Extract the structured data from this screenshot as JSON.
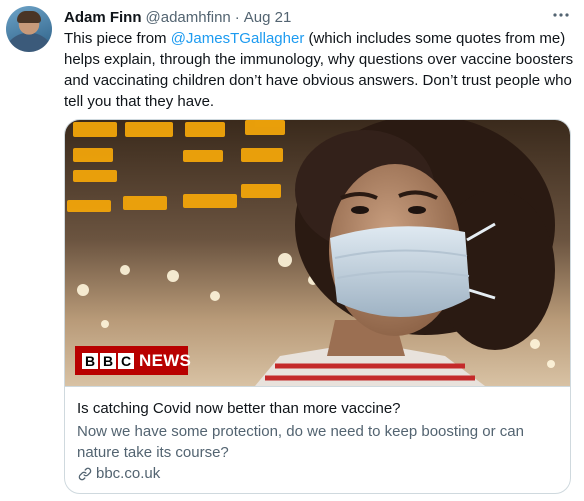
{
  "tweet": {
    "author_name": "Adam Finn",
    "handle": "@adamhfinn",
    "separator": "·",
    "date": "Aug 21",
    "text_before": "This piece from ",
    "mention": "@JamesTGallagher",
    "text_after": " (which includes some quotes from me) helps explain, through the immunology, why questions over vaccine boosters and vaccinating children don’t have obvious answers. Don’t trust people who tell you that they have."
  },
  "card": {
    "image_logo_letters": [
      "B",
      "B",
      "C"
    ],
    "image_logo_word": "NEWS",
    "title": "Is catching Covid now better than more vaccine?",
    "description": "Now we have some protection, do we need to keep boosting or can nature take its course?",
    "domain": "bbc.co.uk"
  },
  "icons": {
    "more": "more-horizontal-icon",
    "link": "link-icon"
  },
  "colors": {
    "accent": "#1d9bf0",
    "secondary_text": "#536471",
    "border": "#cfd9de",
    "bbc_red": "#b80000"
  }
}
